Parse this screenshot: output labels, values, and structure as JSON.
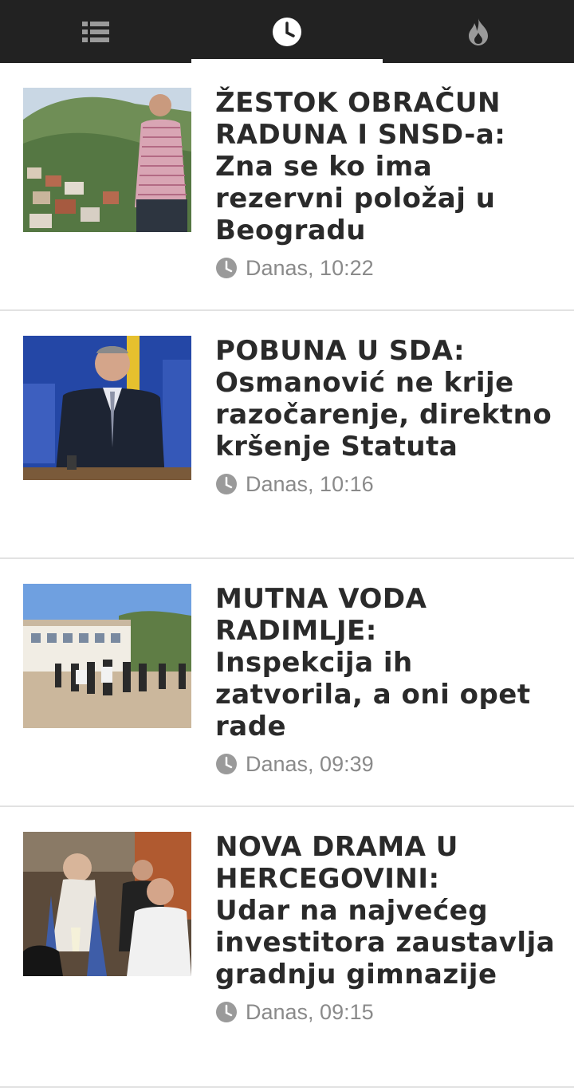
{
  "tabs": [
    {
      "icon": "list-icon",
      "active": false
    },
    {
      "icon": "clock-icon",
      "active": true
    },
    {
      "icon": "fire-icon",
      "active": false
    }
  ],
  "colors": {
    "tabbar_bg": "#222222",
    "tab_icon": "#9a9a9a",
    "tab_icon_active": "#ffffff",
    "headline": "#2a2a2a",
    "meta": "#8a8a8a",
    "divider": "#e2e2e2"
  },
  "articles": [
    {
      "headline_caps": "ŽESTOK OBRAČUN RADUNA I SNSD-a:",
      "headline_rest": "Zna se ko ima rezervni položaj u Beogradu",
      "time": "Danas, 10:22"
    },
    {
      "headline_caps": "POBUNA U SDA:",
      "headline_rest": "Osmanović ne krije razočarenje, direktno kršenje Statuta",
      "time": "Danas, 10:16"
    },
    {
      "headline_caps": "MUTNA VODA RADIMLJE:",
      "headline_rest": "Inspekcija ih zatvorila, a oni opet rade",
      "time": "Danas, 09:39"
    },
    {
      "headline_caps": "NOVA DRAMA U HERCEGOVINI:",
      "headline_rest": "Udar na najvećeg investitora zaustavlja gradnju gimnazije",
      "time": "Danas, 09:15"
    }
  ]
}
